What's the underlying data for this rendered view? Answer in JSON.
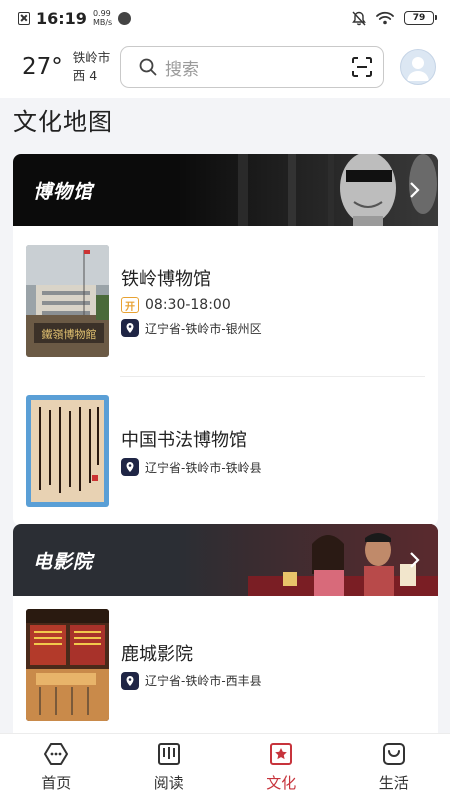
{
  "status_bar": {
    "time": "16:19",
    "net_speed_value": "0.99",
    "net_speed_unit": "MB/s",
    "battery": "79",
    "icons": [
      "x-notification-icon",
      "app-dot-icon",
      "mute-bell-icon",
      "wifi-icon",
      "battery-icon"
    ]
  },
  "header": {
    "temperature": "27°",
    "city": "铁岭市",
    "wind": "西 4",
    "search_placeholder": "搜索",
    "icons": [
      "search-icon",
      "scan-icon",
      "avatar-icon"
    ]
  },
  "page_title": "文化地图",
  "sections": [
    {
      "title": "博物馆",
      "items": [
        {
          "name": "铁岭博物馆",
          "open_badge": "开",
          "hours": "08:30-18:00",
          "address": "辽宁省-铁岭市-银州区"
        },
        {
          "name": "中国书法博物馆",
          "address": "辽宁省-铁岭市-铁岭县"
        }
      ]
    },
    {
      "title": "电影院",
      "items": [
        {
          "name": "鹿城影院",
          "address": "辽宁省-铁岭市-西丰县"
        }
      ]
    }
  ],
  "bottom_nav": [
    {
      "label": "首页",
      "icon": "home-chat-icon",
      "active": false
    },
    {
      "label": "阅读",
      "icon": "book-icon",
      "active": false
    },
    {
      "label": "文化",
      "icon": "culture-star-icon",
      "active": true
    },
    {
      "label": "生活",
      "icon": "life-bag-icon",
      "active": false
    }
  ],
  "colors": {
    "accent": "#c7343c",
    "pin": "#1f2545",
    "open_badge": "#e8a232"
  }
}
